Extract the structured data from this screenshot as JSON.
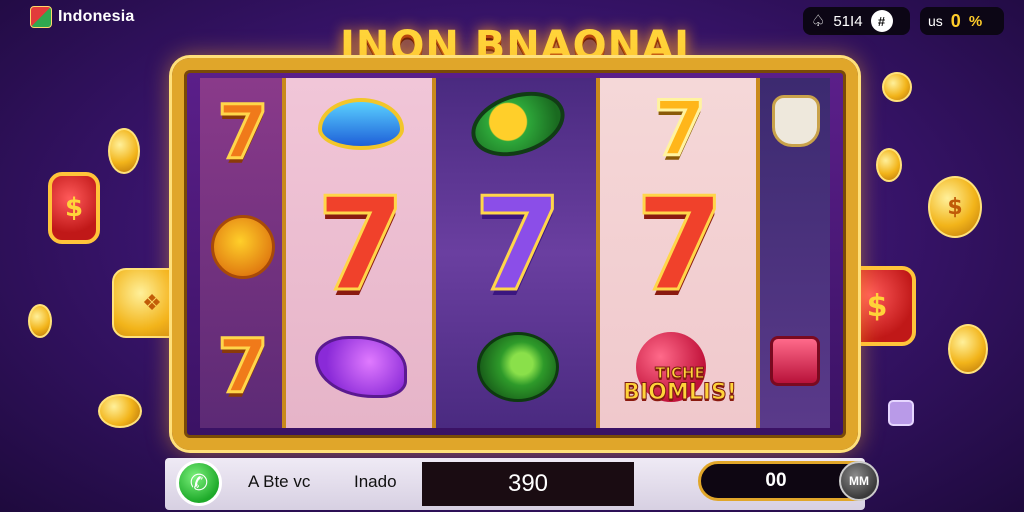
{
  "top_bar": {
    "brand_name": "Indonesia",
    "hud_left_text": "51I4",
    "hud_left_button": "#",
    "hud_right_label": "us",
    "hud_right_value": "0",
    "hud_right_icon": "%"
  },
  "game_title": "INON BNAONAI",
  "reels": {
    "seven": "7",
    "bonus_top": "TICHE",
    "bonus_main": "BIOMLIS!"
  },
  "coins": {
    "dollar": "$"
  },
  "bottom_bar": {
    "label_a": "A Bte vc",
    "label_b": "Inado",
    "value": "390",
    "stake_value": "00",
    "stake_button": "MM"
  },
  "colors": {
    "background": "#3b1570",
    "frame_gold": "#e0a62a",
    "title_yellow": "#ffd43a",
    "accent_green": "#1eaa2a"
  }
}
